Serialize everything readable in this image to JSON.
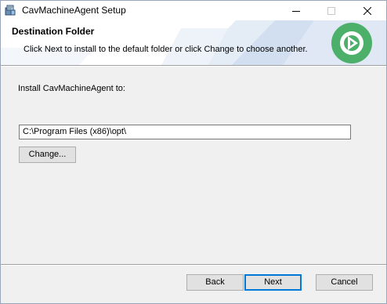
{
  "window": {
    "title": "CavMachineAgent Setup"
  },
  "banner": {
    "title": "Destination Folder",
    "subtitle": "Click Next to install to the default folder or click Change to choose another."
  },
  "body": {
    "install_label": "Install CavMachineAgent to:",
    "path_value": "C:\\Program Files (x86)\\opt\\",
    "change_label": "Change..."
  },
  "footer": {
    "back_label": "Back",
    "next_label": "Next",
    "cancel_label": "Cancel"
  },
  "icons": {
    "app": "installer-icon",
    "logo": "green-circle-logo-icon",
    "minimize": "minimize-icon",
    "maximize": "maximize-icon",
    "close": "close-icon"
  },
  "colors": {
    "logo_green": "#4caf6a",
    "default_button_border": "#0078d7",
    "dialog_background": "#f0f0f0"
  }
}
